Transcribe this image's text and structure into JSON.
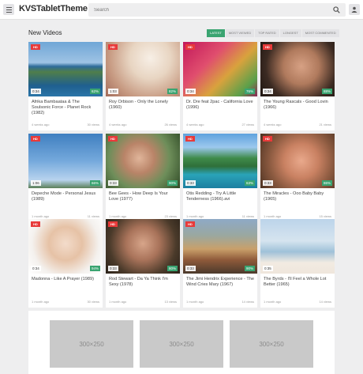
{
  "header": {
    "logo": "KVSTabletTheme",
    "search_placeholder": "Search"
  },
  "main": {
    "section_title": "New Videos",
    "tabs": [
      {
        "label": "LATEST",
        "active": true
      },
      {
        "label": "MOST VIEWED",
        "active": false
      },
      {
        "label": "TOP RATED",
        "active": false
      },
      {
        "label": "LONGEST",
        "active": false
      },
      {
        "label": "MOST COMMENTED",
        "active": false
      }
    ],
    "videos": [
      {
        "badge": "HD",
        "duration": "0:34",
        "rating": "62%",
        "title": "Afrika Bambaataa & The Soulsonic Force - Planet Rock (1982)",
        "age": "4 weeks ago",
        "views": "30 views"
      },
      {
        "badge": "HD",
        "duration": "1:03",
        "rating": "82%",
        "title": "Roy Orbison - Only the Lonely (1960)",
        "age": "4 weeks ago",
        "views": "26 views"
      },
      {
        "badge": "HD",
        "duration": "0:34",
        "rating": "76%",
        "title": "Dr. Dre feat 2pac - California Love (1996)",
        "age": "4 weeks ago",
        "views": "27 views"
      },
      {
        "badge": "HD",
        "duration": "0:34",
        "rating": "88%",
        "title": "The Young Rascals - Good Lovin (1966)",
        "age": "4 weeks ago",
        "views": "21 views"
      },
      {
        "badge": "HD",
        "duration": "1:06",
        "rating": "66%",
        "title": "Depeche Mode - Personal Jesus (1989)",
        "age": "1 month ago",
        "views": "11 views"
      },
      {
        "badge": "HD",
        "duration": "0:33",
        "rating": "90%",
        "title": "Bee Gees - How Deep Is Your Love (1977)",
        "age": "1 month ago",
        "views": "23 views"
      },
      {
        "badge": "HD",
        "duration": "0:33",
        "rating": "63%",
        "title": "Otis Redding - Try A Little Tenderness (1966).avi",
        "age": "1 month ago",
        "views": "11 views"
      },
      {
        "badge": "HD",
        "duration": "0:33",
        "rating": "86%",
        "title": "The Miracles - Ooo Baby Baby (1965)",
        "age": "1 month ago",
        "views": "15 views"
      },
      {
        "badge": "HD",
        "duration": "0:34",
        "rating": "94%",
        "title": "Madonna - Like A Prayer (1989)",
        "age": "1 month ago",
        "views": "30 views"
      },
      {
        "badge": "HD",
        "duration": "0:33",
        "rating": "80%",
        "title": "Rod Stewart - Da Ya Think I'm Sexy (1978)",
        "age": "1 month ago",
        "views": "13 views"
      },
      {
        "badge": "HD",
        "duration": "0:33",
        "rating": "90%",
        "title": "The Jimi Hendrix Experience - The Wind Cries Mary (1967)",
        "age": "1 month ago",
        "views": "14 views"
      },
      {
        "badge": "",
        "duration": "0:35",
        "rating": "",
        "title": "The Byrds - I'll Feel a Whole Lot Better (1965)",
        "age": "1 month ago",
        "views": "14 views"
      }
    ]
  },
  "ads": [
    {
      "label": "300×250"
    },
    {
      "label": "300×250"
    },
    {
      "label": "300×250"
    }
  ],
  "colors": {
    "accent": "#3aa471",
    "hd_badge": "#e83a3a",
    "page_background": "#eeeeef"
  }
}
